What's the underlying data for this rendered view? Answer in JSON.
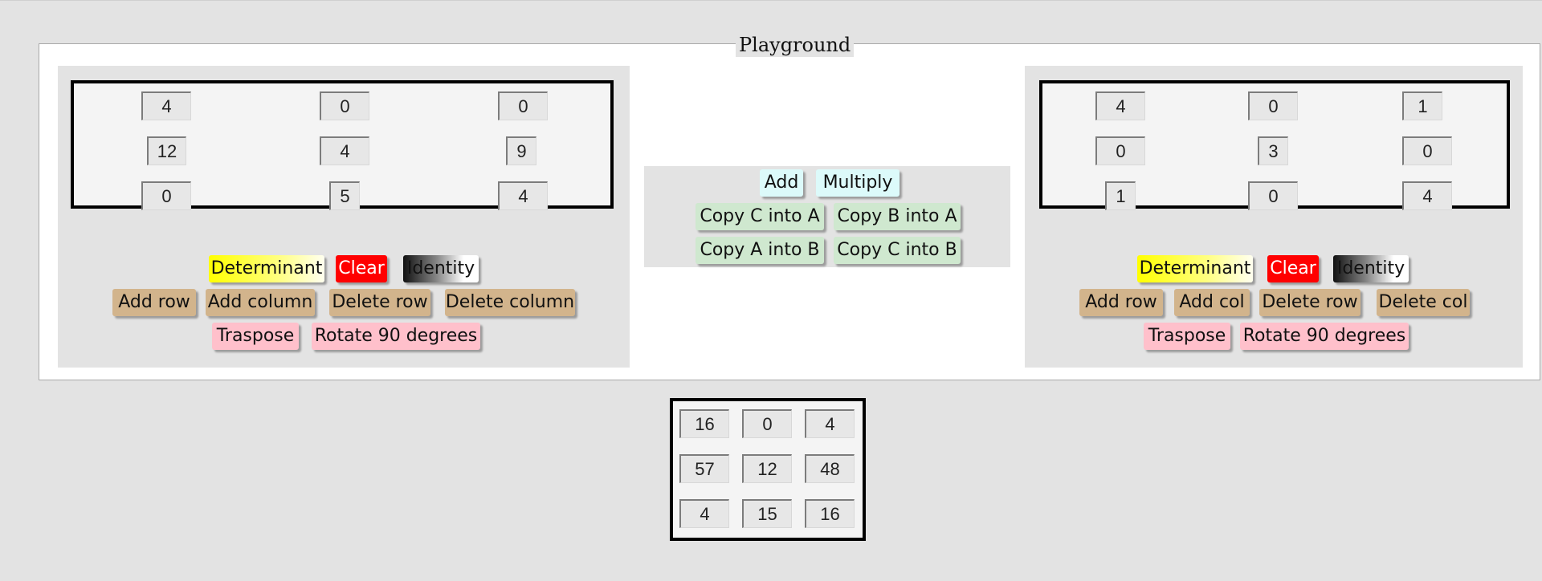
{
  "playground": {
    "legend": "Playground"
  },
  "matrix_a": {
    "rows": [
      [
        "4",
        "0",
        "0"
      ],
      [
        "12",
        "4",
        "9"
      ],
      [
        "0",
        "5",
        "4"
      ]
    ],
    "buttons": {
      "determinant": "Determinant",
      "clear": "Clear",
      "identity": "Identity",
      "add_row": "Add row",
      "add_column": "Add column",
      "delete_row": "Delete row",
      "delete_column": "Delete column",
      "transpose": "Traspose",
      "rotate": "Rotate 90 degrees"
    }
  },
  "operations": {
    "add": "Add",
    "multiply": "Multiply",
    "copy_c_into_a": "Copy C into A",
    "copy_b_into_a": "Copy B into A",
    "copy_a_into_b": "Copy A into B",
    "copy_c_into_b": "Copy C into B"
  },
  "matrix_b": {
    "rows": [
      [
        "4",
        "0",
        "1"
      ],
      [
        "0",
        "3",
        "0"
      ],
      [
        "1",
        "0",
        "4"
      ]
    ],
    "buttons": {
      "determinant": "Determinant",
      "clear": "Clear",
      "identity": "Identity",
      "add_row": "Add row",
      "add_column": "Add col",
      "delete_row": "Delete row",
      "delete_column": "Delete col",
      "transpose": "Traspose",
      "rotate": "Rotate 90 degrees"
    }
  },
  "matrix_c": {
    "rows": [
      [
        "16",
        "0",
        "4"
      ],
      [
        "57",
        "12",
        "48"
      ],
      [
        "4",
        "15",
        "16"
      ]
    ]
  }
}
